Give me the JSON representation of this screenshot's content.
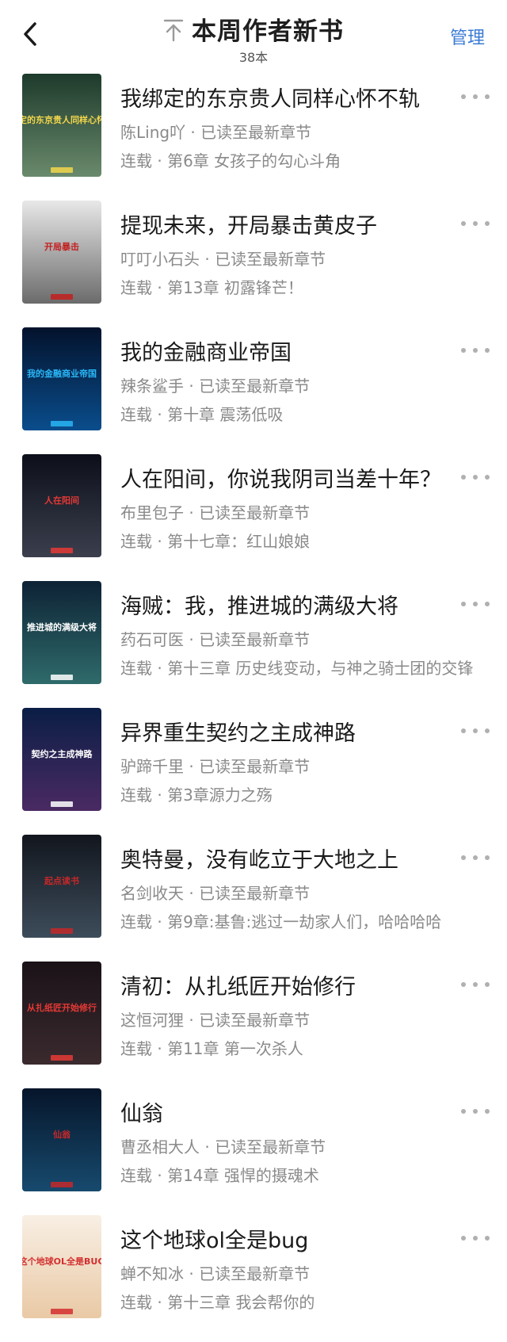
{
  "header": {
    "title": "本周作者新书",
    "subtitle": "38本",
    "manage_label": "管理",
    "back_icon": "chevron-left-icon",
    "sort_icon": "arrow-up-to-line-icon",
    "accent_color": "#3a7bd5"
  },
  "books": [
    {
      "title": "我绑定的东京贵人同样心怀不轨",
      "author": "陈Ling吖",
      "progress": "已读至最新章节",
      "status": "连载",
      "chapter": "第6章 女孩子的勾心斗角",
      "cover_text": "我绑定的东京贵人同样心怀不轨"
    },
    {
      "title": "提现未来，开局暴击黄皮子",
      "author": "叮叮小石头",
      "progress": "已读至最新章节",
      "status": "连载",
      "chapter": "第13章 初露锋芒！",
      "cover_text": "开局暴击"
    },
    {
      "title": "我的金融商业帝国",
      "author": "辣条鲨手",
      "progress": "已读至最新章节",
      "status": "连载",
      "chapter": "第十章 震荡低吸",
      "cover_text": "我的金融商业帝国"
    },
    {
      "title": "人在阳间，你说我阴司当差十年？",
      "author": "布里包子",
      "progress": "已读至最新章节",
      "status": "连载",
      "chapter": "第十七章：红山娘娘",
      "cover_text": "人在阳间"
    },
    {
      "title": "海贼：我，推进城的满级大将",
      "author": "药石可医",
      "progress": "已读至最新章节",
      "status": "连载",
      "chapter": "第十三章 历史线变动，与神之骑士团的交锋",
      "cover_text": "推进城的满级大将"
    },
    {
      "title": "异界重生契约之主成神路",
      "author": "驴蹄千里",
      "progress": "已读至最新章节",
      "status": "连载",
      "chapter": "第3章源力之殇",
      "cover_text": "契约之主成神路"
    },
    {
      "title": "奥特曼，没有屹立于大地之上",
      "author": "名剑收天",
      "progress": "已读至最新章节",
      "status": "连载",
      "chapter": "第9章:基鲁:逃过一劫家人们，哈哈哈哈",
      "cover_text": "起点读书"
    },
    {
      "title": "清初：从扎纸匠开始修行",
      "author": "这恒河狸",
      "progress": "已读至最新章节",
      "status": "连载",
      "chapter": "第11章 第一次杀人",
      "cover_text": "从扎纸匠开始修行"
    },
    {
      "title": "仙翁",
      "author": "曹丞相大人",
      "progress": "已读至最新章节",
      "status": "连载",
      "chapter": "第14章 强悍的摄魂术",
      "cover_text": "仙翁"
    },
    {
      "title": "这个地球ol全是bug",
      "author": "蝉不知冰",
      "progress": "已读至最新章节",
      "status": "连载",
      "chapter": "第十三章 我会帮你的",
      "cover_text": "这个地球OL全是BUG"
    }
  ],
  "more_icon": "more-horizontal-icon",
  "separator": " · "
}
